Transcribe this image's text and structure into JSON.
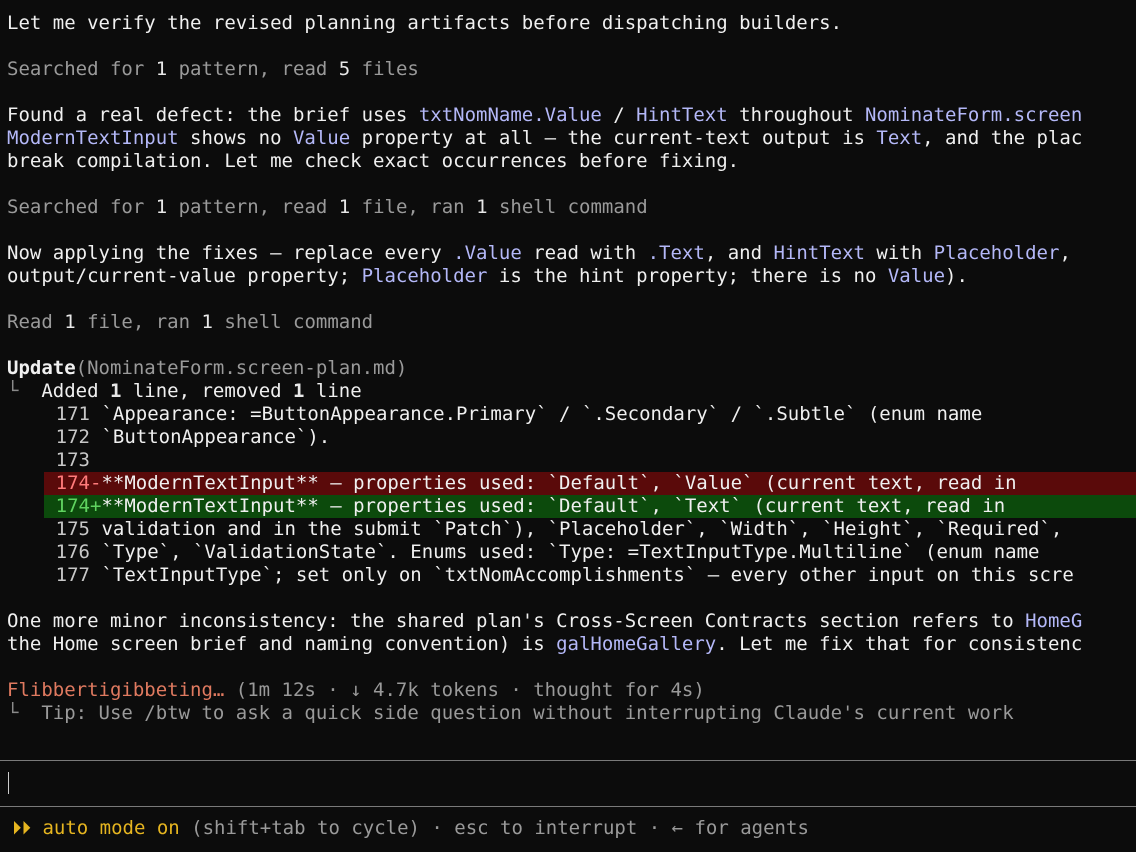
{
  "lines": {
    "intro": "Let me verify the revised planning artifacts before dispatching builders.",
    "search1_a": "Searched for ",
    "search1_n1": "1",
    "search1_b": " pattern, read ",
    "search1_n2": "5",
    "search1_c": " files",
    "defect1_a": "Found a real defect: the brief uses ",
    "defect1_code1": "txtNomName.Value",
    "defect1_b": " / ",
    "defect1_code2": "HintText",
    "defect1_c": " throughout ",
    "defect1_code3": "NominateForm.screen",
    "defect2_code1": "ModernTextInput",
    "defect2_a": " shows no ",
    "defect2_code2": "Value",
    "defect2_b": " property at all — the current-text output is ",
    "defect2_code3": "Text",
    "defect2_c": ", and the plac",
    "defect3": "break compilation. Let me check exact occurrences before fixing.",
    "search2_a": "Searched for ",
    "search2_n1": "1",
    "search2_b": " pattern, read ",
    "search2_n2": "1",
    "search2_c": " file, ran ",
    "search2_n3": "1",
    "search2_d": " shell command",
    "apply1_a": "Now applying the fixes — replace every ",
    "apply1_code1": ".Value",
    "apply1_b": " read with ",
    "apply1_code2": ".Text",
    "apply1_c": ", and ",
    "apply1_code3": "HintText",
    "apply1_d": " with ",
    "apply1_code4": "Placeholder",
    "apply1_e": ",",
    "apply2_a": "output/current-value property; ",
    "apply2_code1": "Placeholder",
    "apply2_b": " is the hint property; there is no ",
    "apply2_code2": "Value",
    "apply2_c": ").",
    "read_a": "Read ",
    "read_n1": "1",
    "read_b": " file, ran ",
    "read_n2": "1",
    "read_c": " shell command",
    "update_a": "Update",
    "update_b": "(NominateForm.screen-plan.md)",
    "added_tree": "└",
    "added_a": "  Added ",
    "added_n1": "1",
    "added_b": " line, removed ",
    "added_n2": "1",
    "added_c": " line",
    "minor1_a": "One more minor inconsistency: the shared plan's Cross-Screen Contracts section refers to ",
    "minor1_code": "HomeG",
    "minor2_a": "the Home screen brief and naming convention) is ",
    "minor2_code": "galHomeGallery",
    "minor2_b": ". Let me fix that for consistenc",
    "spinner": "Flibbertigibbeting…",
    "spinner_meta": " (1m 12s · ↓ 4.7k tokens · thought for 4s)",
    "tip_tree": "└",
    "tip": "  Tip: Use /btw to ask a quick side question without interrupting Claude's current work"
  },
  "diff": [
    {
      "num": "171",
      "sign": " ",
      "text": "`Appearance: =ButtonAppearance.Primary` / `.Secondary` / `.Subtle` (enum name",
      "kind": "ctx"
    },
    {
      "num": "172",
      "sign": " ",
      "text": "`ButtonAppearance`).",
      "kind": "ctx"
    },
    {
      "num": "173",
      "sign": " ",
      "text": "",
      "kind": "ctx"
    },
    {
      "num": "174",
      "sign": "-",
      "text": "**ModernTextInput** — properties used: `Default`, `Value` (current text, read in",
      "kind": "del"
    },
    {
      "num": "174",
      "sign": "+",
      "text": "**ModernTextInput** — properties used: `Default`, `Text` (current text, read in",
      "kind": "add"
    },
    {
      "num": "175",
      "sign": " ",
      "text": "validation and in the submit `Patch`), `Placeholder`, `Width`, `Height`, `Required`,",
      "kind": "ctx"
    },
    {
      "num": "176",
      "sign": " ",
      "text": "`Type`, `ValidationState`. Enums used: `Type: =TextInputType.Multiline` (enum name",
      "kind": "ctx"
    },
    {
      "num": "177",
      "sign": " ",
      "text": "`TextInputType`; set only on `txtNomAccomplishments` — every other input on this scre",
      "kind": "ctx"
    }
  ],
  "status": {
    "icon": "⏵⏵",
    "mode": " auto mode on",
    "rest": " (shift+tab to cycle) · esc to interrupt · ← for agents"
  },
  "colors": {
    "background": "#0c0c0c",
    "code": "#b4b8f8",
    "deleted_bg": "#5a0a0a",
    "added_bg": "#0c4a0c",
    "spinner": "#e07a60",
    "auto_mode": "#e6b520"
  }
}
